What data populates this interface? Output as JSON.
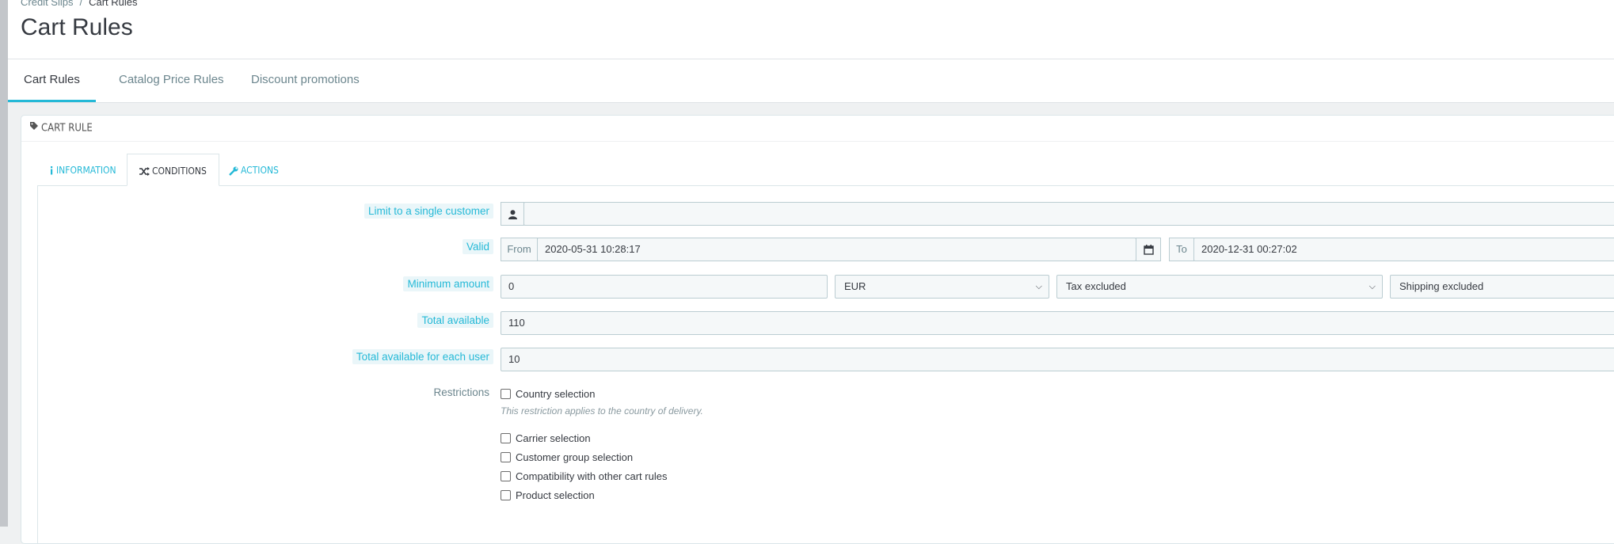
{
  "breadcrumb": {
    "parent": "Credit Slips",
    "separator": "/",
    "current": "Cart Rules"
  },
  "page": {
    "title": "Cart Rules"
  },
  "top_tabs": [
    {
      "label": "Cart Rules",
      "active": true
    },
    {
      "label": "Catalog Price Rules",
      "active": false
    },
    {
      "label": "Discount promotions",
      "active": false
    }
  ],
  "panel": {
    "heading": "CART RULE",
    "icon": "tag-icon"
  },
  "inner_tabs": [
    {
      "label": "INFORMATION",
      "icon": "info-icon",
      "active": false
    },
    {
      "label": "CONDITIONS",
      "icon": "shuffle-icon",
      "active": true
    },
    {
      "label": "ACTIONS",
      "icon": "wrench-icon",
      "active": false
    }
  ],
  "form": {
    "customer": {
      "label": "Limit to a single customer",
      "value": ""
    },
    "valid": {
      "label": "Valid",
      "from_label": "From",
      "from_value": "2020-05-31 10:28:17",
      "to_label": "To",
      "to_value": "2020-12-31 00:27:02"
    },
    "minimum_amount": {
      "label": "Minimum amount",
      "value": "0",
      "currency": "EUR",
      "tax": "Tax excluded",
      "shipping": "Shipping excluded"
    },
    "total_available": {
      "label": "Total available",
      "value": "110"
    },
    "total_per_user": {
      "label": "Total available for each user",
      "value": "10"
    },
    "restrictions": {
      "label": "Restrictions",
      "country": "Country selection",
      "country_help": "This restriction applies to the country of delivery.",
      "carrier": "Carrier selection",
      "customer_group": "Customer group selection",
      "compatibility": "Compatibility with other cart rules",
      "product": "Product selection"
    }
  },
  "colors": {
    "accent": "#25b9d7",
    "text": "#363a41",
    "muted": "#6c868e"
  }
}
